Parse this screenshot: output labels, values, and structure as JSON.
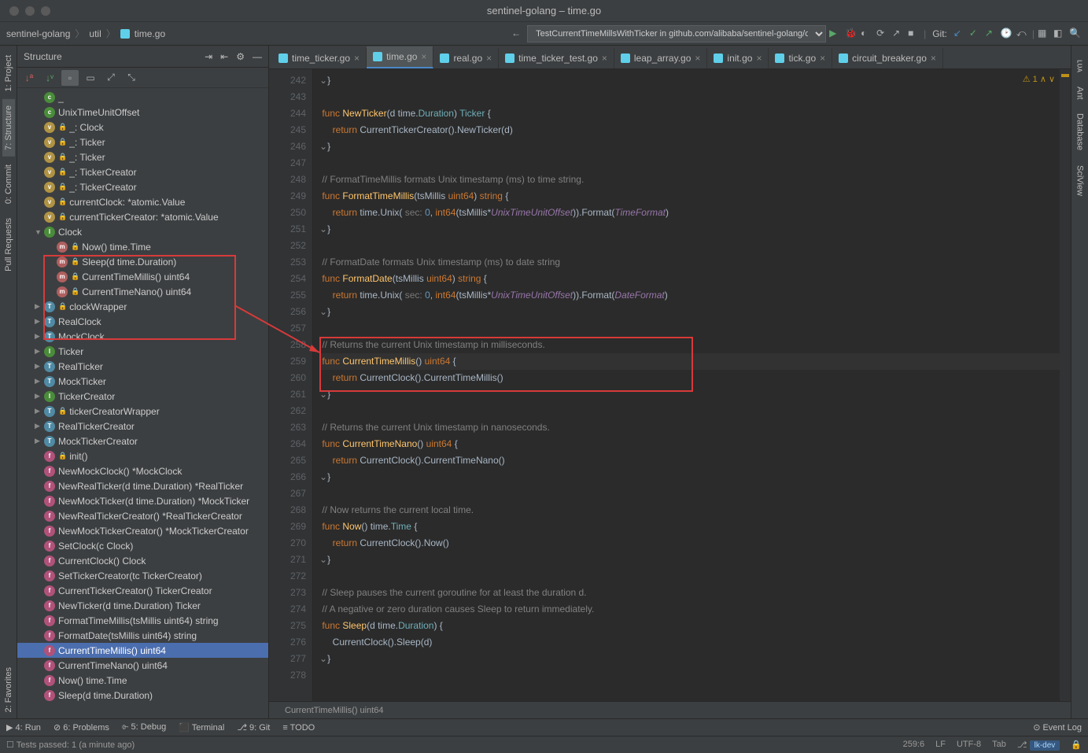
{
  "title": "sentinel-golang – time.go",
  "breadcrumb": [
    "sentinel-golang",
    "util",
    "time.go"
  ],
  "runConfig": "TestCurrentTimeMillsWithTicker in github.com/alibaba/sentinel-golang/clock",
  "gitLabel": "Git:",
  "structurePanel": {
    "title": "Structure"
  },
  "leftTabs": [
    "1: Project",
    "7: Structure",
    "0: Commit",
    "Pull Requests",
    "2: Favorites"
  ],
  "rightTabs": [
    "ʟᴜᴀ",
    "Ant",
    "Database",
    "SciView"
  ],
  "structureItems": [
    {
      "icon": "c",
      "lock": false,
      "label": "_",
      "indent": 1,
      "arrow": ""
    },
    {
      "icon": "c",
      "lock": false,
      "label": "UnixTimeUnitOffset",
      "indent": 1,
      "arrow": ""
    },
    {
      "icon": "v",
      "lock": true,
      "label": "_: Clock",
      "indent": 1,
      "arrow": ""
    },
    {
      "icon": "v",
      "lock": true,
      "label": "_: Ticker",
      "indent": 1,
      "arrow": ""
    },
    {
      "icon": "v",
      "lock": true,
      "label": "_: Ticker",
      "indent": 1,
      "arrow": ""
    },
    {
      "icon": "v",
      "lock": true,
      "label": "_: TickerCreator",
      "indent": 1,
      "arrow": ""
    },
    {
      "icon": "v",
      "lock": true,
      "label": "_: TickerCreator",
      "indent": 1,
      "arrow": ""
    },
    {
      "icon": "v",
      "lock": true,
      "label": "currentClock: *atomic.Value",
      "indent": 1,
      "arrow": ""
    },
    {
      "icon": "v",
      "lock": true,
      "label": "currentTickerCreator: *atomic.Value",
      "indent": 1,
      "arrow": ""
    },
    {
      "icon": "i",
      "lock": false,
      "label": "Clock",
      "indent": 1,
      "arrow": "▼"
    },
    {
      "icon": "m",
      "lock": true,
      "label": "Now() time.Time",
      "indent": 2,
      "arrow": ""
    },
    {
      "icon": "m",
      "lock": true,
      "label": "Sleep(d time.Duration)",
      "indent": 2,
      "arrow": ""
    },
    {
      "icon": "m",
      "lock": true,
      "label": "CurrentTimeMillis() uint64",
      "indent": 2,
      "arrow": ""
    },
    {
      "icon": "m",
      "lock": true,
      "label": "CurrentTimeNano() uint64",
      "indent": 2,
      "arrow": ""
    },
    {
      "icon": "t",
      "lock": true,
      "label": "clockWrapper",
      "indent": 1,
      "arrow": "▶"
    },
    {
      "icon": "t",
      "lock": false,
      "label": "RealClock",
      "indent": 1,
      "arrow": "▶"
    },
    {
      "icon": "t",
      "lock": false,
      "label": "MockClock",
      "indent": 1,
      "arrow": "▶"
    },
    {
      "icon": "i",
      "lock": false,
      "label": "Ticker",
      "indent": 1,
      "arrow": "▶"
    },
    {
      "icon": "t",
      "lock": false,
      "label": "RealTicker",
      "indent": 1,
      "arrow": "▶"
    },
    {
      "icon": "t",
      "lock": false,
      "label": "MockTicker",
      "indent": 1,
      "arrow": "▶"
    },
    {
      "icon": "i",
      "lock": false,
      "label": "TickerCreator",
      "indent": 1,
      "arrow": "▶"
    },
    {
      "icon": "t",
      "lock": true,
      "label": "tickerCreatorWrapper",
      "indent": 1,
      "arrow": "▶"
    },
    {
      "icon": "t",
      "lock": false,
      "label": "RealTickerCreator",
      "indent": 1,
      "arrow": "▶"
    },
    {
      "icon": "t",
      "lock": false,
      "label": "MockTickerCreator",
      "indent": 1,
      "arrow": "▶"
    },
    {
      "icon": "f",
      "lock": true,
      "label": "init()",
      "indent": 1,
      "arrow": ""
    },
    {
      "icon": "f",
      "lock": false,
      "label": "NewMockClock() *MockClock",
      "indent": 1,
      "arrow": ""
    },
    {
      "icon": "f",
      "lock": false,
      "label": "NewRealTicker(d time.Duration) *RealTicker",
      "indent": 1,
      "arrow": ""
    },
    {
      "icon": "f",
      "lock": false,
      "label": "NewMockTicker(d time.Duration) *MockTicker",
      "indent": 1,
      "arrow": ""
    },
    {
      "icon": "f",
      "lock": false,
      "label": "NewRealTickerCreator() *RealTickerCreator",
      "indent": 1,
      "arrow": ""
    },
    {
      "icon": "f",
      "lock": false,
      "label": "NewMockTickerCreator() *MockTickerCreator",
      "indent": 1,
      "arrow": ""
    },
    {
      "icon": "f",
      "lock": false,
      "label": "SetClock(c Clock)",
      "indent": 1,
      "arrow": ""
    },
    {
      "icon": "f",
      "lock": false,
      "label": "CurrentClock() Clock",
      "indent": 1,
      "arrow": ""
    },
    {
      "icon": "f",
      "lock": false,
      "label": "SetTickerCreator(tc TickerCreator)",
      "indent": 1,
      "arrow": ""
    },
    {
      "icon": "f",
      "lock": false,
      "label": "CurrentTickerCreator() TickerCreator",
      "indent": 1,
      "arrow": ""
    },
    {
      "icon": "f",
      "lock": false,
      "label": "NewTicker(d time.Duration) Ticker",
      "indent": 1,
      "arrow": ""
    },
    {
      "icon": "f",
      "lock": false,
      "label": "FormatTimeMillis(tsMillis uint64) string",
      "indent": 1,
      "arrow": ""
    },
    {
      "icon": "f",
      "lock": false,
      "label": "FormatDate(tsMillis uint64) string",
      "indent": 1,
      "arrow": ""
    },
    {
      "icon": "f",
      "lock": false,
      "label": "CurrentTimeMillis() uint64",
      "indent": 1,
      "arrow": "",
      "selected": true
    },
    {
      "icon": "f",
      "lock": false,
      "label": "CurrentTimeNano() uint64",
      "indent": 1,
      "arrow": ""
    },
    {
      "icon": "f",
      "lock": false,
      "label": "Now() time.Time",
      "indent": 1,
      "arrow": ""
    },
    {
      "icon": "f",
      "lock": false,
      "label": "Sleep(d time.Duration)",
      "indent": 1,
      "arrow": ""
    }
  ],
  "tabs": [
    {
      "name": "time_ticker.go"
    },
    {
      "name": "time.go",
      "active": true
    },
    {
      "name": "real.go"
    },
    {
      "name": "time_ticker_test.go"
    },
    {
      "name": "leap_array.go"
    },
    {
      "name": "init.go"
    },
    {
      "name": "tick.go"
    },
    {
      "name": "circuit_breaker.go"
    }
  ],
  "code": {
    "startLine": 242,
    "currentLine": 259,
    "lines": [
      "<span class='fold'>⌄</span><span class='par'>}</span>",
      "",
      " <span class='kw'>func</span> <span class='fn'>NewTicker</span><span class='par'>(d time.</span><span class='typ'>Duration</span><span class='par'>)</span> <span class='typ'>Ticker</span> <span class='par'>{</span>",
      "     <span class='kw'>return</span> <span class='par'>CurrentTickerCreator().NewTicker(d)</span>",
      "<span class='fold'>⌄</span><span class='par'>}</span>",
      "",
      " <span class='com'>// FormatTimeMillis formats Unix timestamp (ms) to time string.</span>",
      " <span class='kw'>func</span> <span class='fn'>FormatTimeMillis</span><span class='par'>(tsMillis </span><span class='kw'>uint64</span><span class='par'>)</span> <span class='kw'>string</span> <span class='par'>{</span>",
      "     <span class='kw'>return</span> <span class='par'>time.Unix(</span> <span class='hint'>sec:</span> <span class='num'>0</span><span class='par'>, </span><span class='kw'>int64</span><span class='par'>(tsMillis*</span><span class='ident'>UnixTimeUnitOffset</span><span class='par'>)).Format(</span><span class='ident'>TimeFormat</span><span class='par'>)</span>",
      "<span class='fold'>⌄</span><span class='par'>}</span>",
      "",
      " <span class='com'>// FormatDate formats Unix timestamp (ms) to date string</span>",
      " <span class='kw'>func</span> <span class='fn'>FormatDate</span><span class='par'>(tsMillis </span><span class='kw'>uint64</span><span class='par'>)</span> <span class='kw'>string</span> <span class='par'>{</span>",
      "     <span class='kw'>return</span> <span class='par'>time.Unix(</span> <span class='hint'>sec:</span> <span class='num'>0</span><span class='par'>, </span><span class='kw'>int64</span><span class='par'>(tsMillis*</span><span class='ident'>UnixTimeUnitOffset</span><span class='par'>)).Format(</span><span class='ident'>DateFormat</span><span class='par'>)</span>",
      "<span class='fold'>⌄</span><span class='par'>}</span>",
      "",
      " <span class='com'>// Returns the current Unix timestamp in milliseconds.</span>",
      " <span class='kw'>func</span> <span class='fn'>CurrentTimeMillis</span><span class='par'>()</span> <span class='kw'>uint64</span> <span class='par'>{</span>",
      "     <span class='kw'>return</span> <span class='par'>CurrentClock().CurrentTimeMillis()</span>",
      "<span class='fold'>⌄</span><span class='par'>}</span>",
      "",
      " <span class='com'>// Returns the current Unix timestamp in nanoseconds.</span>",
      " <span class='kw'>func</span> <span class='fn'>CurrentTimeNano</span><span class='par'>()</span> <span class='kw'>uint64</span> <span class='par'>{</span>",
      "     <span class='kw'>return</span> <span class='par'>CurrentClock().CurrentTimeNano()</span>",
      "<span class='fold'>⌄</span><span class='par'>}</span>",
      "",
      " <span class='com'>// Now returns the current local time.</span>",
      " <span class='kw'>func</span> <span class='fn'>Now</span><span class='par'>()</span> <span class='par'>time.</span><span class='typ'>Time</span> <span class='par'>{</span>",
      "     <span class='kw'>return</span> <span class='par'>CurrentClock().Now()</span>",
      "<span class='fold'>⌄</span><span class='par'>}</span>",
      "",
      " <span class='com'>// Sleep pauses the current goroutine for at least the duration d.</span>",
      " <span class='com'>// A negative or zero duration causes Sleep to return immediately.</span>",
      " <span class='kw'>func</span> <span class='fn'>Sleep</span><span class='par'>(d time.</span><span class='typ'>Duration</span><span class='par'>) {</span>",
      "     <span class='par'>CurrentClock().Sleep(d)</span>",
      "<span class='fold'>⌄</span><span class='par'>}</span>",
      ""
    ]
  },
  "editorFooter": "CurrentTimeMillis() uint64",
  "warnings": "⚠ 1  ∧  ∨",
  "bottomTabs": {
    "left": [
      "▶ 4: Run",
      "⊘ 6: Problems",
      "⌱ 5: Debug",
      "⬛ Terminal",
      "⎇ 9: Git",
      "≡ TODO"
    ],
    "right": [
      "⊙ Event Log"
    ]
  },
  "status": {
    "msg": "Tests passed: 1 (a minute ago)",
    "pos": "259:6",
    "lf": "LF",
    "enc": "UTF-8",
    "tab": "Tab",
    "branch": "lk-dev"
  }
}
